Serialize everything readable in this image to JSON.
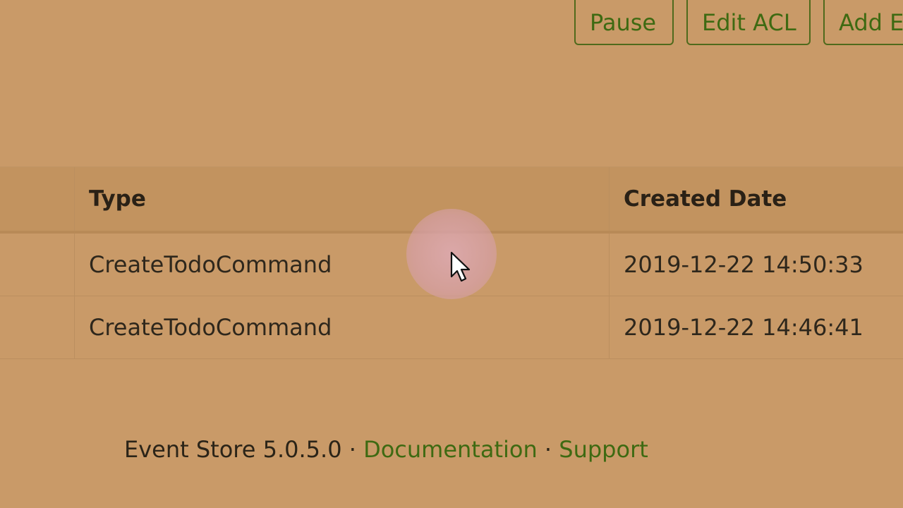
{
  "toolbar": {
    "pause_label": "Pause",
    "edit_acl_label": "Edit ACL",
    "add_event_label": "Add E"
  },
  "table": {
    "headers": [
      "",
      "Type",
      "Created Date"
    ],
    "rows": [
      {
        "type": "CreateTodoCommand",
        "created": "2019-12-22 14:50:33"
      },
      {
        "type": "CreateTodoCommand",
        "created": "2019-12-22 14:46:41"
      }
    ]
  },
  "footer": {
    "product": "Event Store 5.0.5.0",
    "separator": "·",
    "documentation_label": "Documentation",
    "support_label": "Support"
  },
  "colors": {
    "background": "#c99a68",
    "accent": "#3e6a12"
  },
  "icons": {
    "cursor": "arrow-cursor-icon"
  }
}
